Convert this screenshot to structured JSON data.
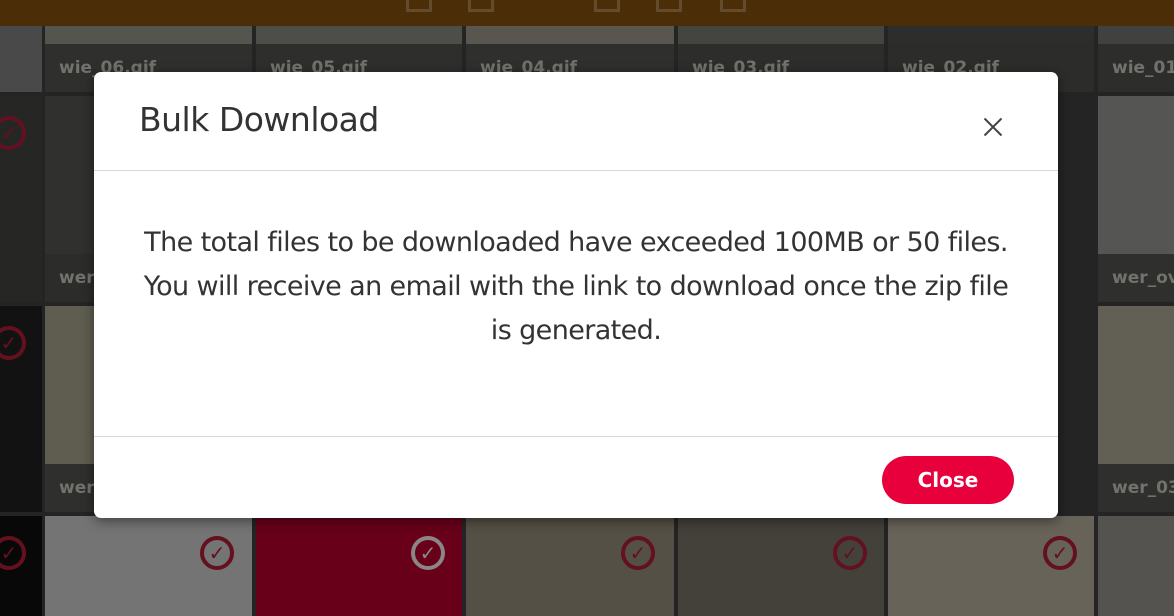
{
  "tiles": {
    "row1": [
      "",
      "wie_06.gif",
      "wie_05.gif",
      "wie_04.gif",
      "wie_03.gif",
      "wie_02.gif",
      "wie_01."
    ],
    "row2": [
      "",
      "wer_",
      "",
      "",
      "",
      "",
      "wer_ove"
    ],
    "row3": [
      "",
      "wer_",
      "",
      "",
      "",
      "",
      "wer_03."
    ]
  },
  "check_glyph": "✓",
  "modal": {
    "title": "Bulk Download",
    "message": "The total files to be downloaded have exceeded 100MB or 50 files. You will receive an email with the link to download once the zip file is generated.",
    "close_button": "Close",
    "close_icon": "close-icon"
  },
  "colors": {
    "topbar": "#7a4a0e",
    "accent": "#e8003d",
    "check": "#a01a34"
  }
}
